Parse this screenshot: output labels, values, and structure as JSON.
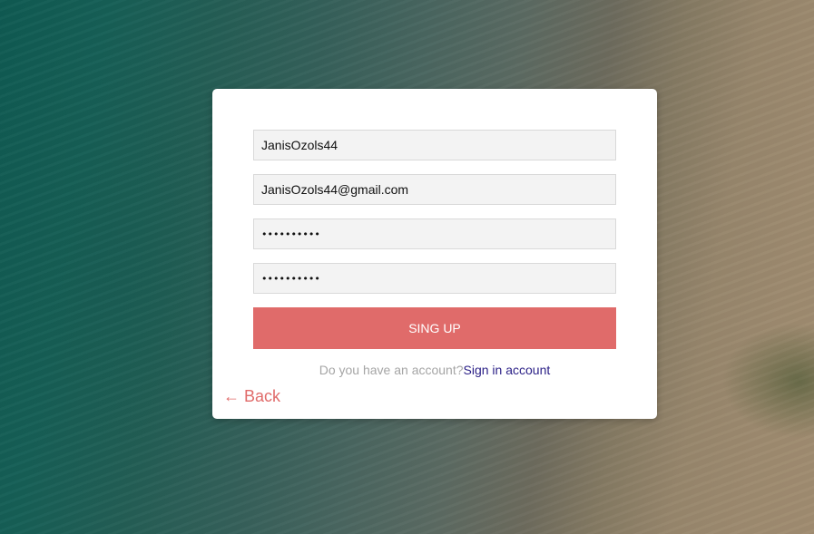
{
  "form": {
    "username_value": "JanisOzols44",
    "email_value": "JanisOzols44@gmail.com",
    "password_value": "••••••••••",
    "confirm_password_value": "••••••••••",
    "submit_label": "SING UP",
    "account_prompt": "Do you have an account?",
    "signin_label": "Sign in account",
    "back_label": "← Back"
  },
  "colors": {
    "accent": "#e06b6a",
    "link": "#2a1f86",
    "field_bg": "#f3f3f3",
    "card_bg": "#ffffff"
  }
}
